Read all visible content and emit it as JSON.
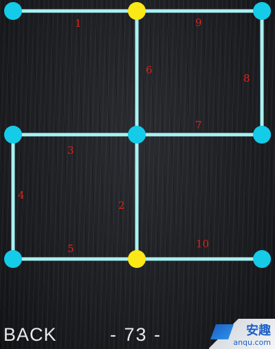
{
  "puzzle": {
    "edge_labels": [
      "1",
      "2",
      "3",
      "4",
      "5",
      "6",
      "7",
      "8",
      "9",
      "10"
    ],
    "line_color": "#a9f1f3",
    "node_color": "#14cbe8",
    "start_node_color": "#fbe817",
    "label_color": "#e0231b",
    "nodes": [
      {
        "id": "n1",
        "start": false
      },
      {
        "id": "n2",
        "start": true
      },
      {
        "id": "n3",
        "start": false
      },
      {
        "id": "n4",
        "start": false
      },
      {
        "id": "n5",
        "start": false
      },
      {
        "id": "n6",
        "start": false
      },
      {
        "id": "n7",
        "start": false
      },
      {
        "id": "n8",
        "start": true
      },
      {
        "id": "n9",
        "start": false
      }
    ]
  },
  "footer": {
    "back_label": "BACK",
    "level_label": "- 73 -"
  },
  "watermark": {
    "title": "安趣",
    "domain": "anqu.com"
  }
}
